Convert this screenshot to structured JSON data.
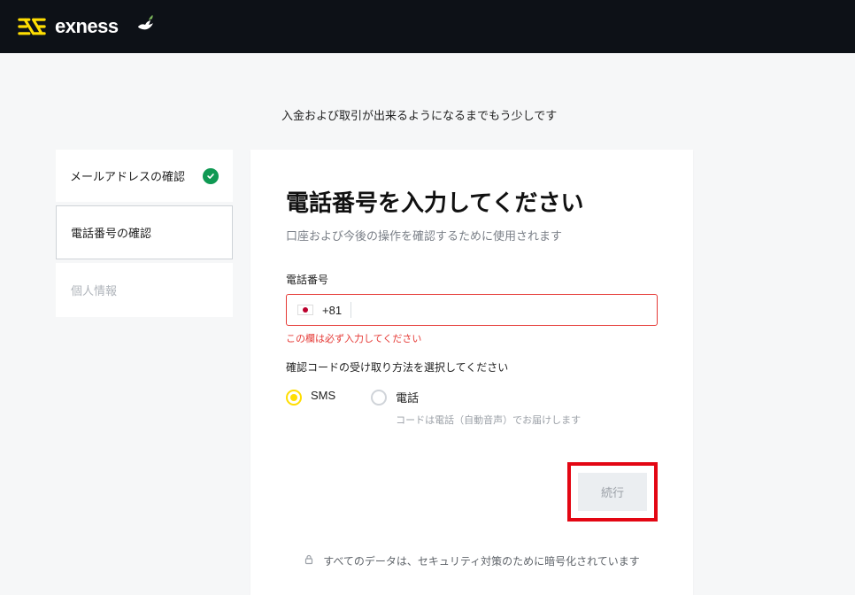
{
  "brand": {
    "name": "exness"
  },
  "page_subtitle": "入金および取引が出来るようになるまでもう少しです",
  "sidebar": {
    "items": [
      {
        "label": "メールアドレスの確認",
        "status": "completed"
      },
      {
        "label": "電話番号の確認",
        "status": "active"
      },
      {
        "label": "個人情報",
        "status": "disabled"
      }
    ]
  },
  "form": {
    "title": "電話番号を入力してください",
    "description": "口座および今後の操作を確認するために使用されます",
    "phone_field_label": "電話番号",
    "dial_code": "+81",
    "error_message": "この欄は必ず入力してください",
    "method_label": "確認コードの受け取り方法を選択してください",
    "radio_options": {
      "sms": {
        "label": "SMS",
        "selected": true
      },
      "phone": {
        "label": "電話",
        "hint": "コードは電話（自動音声）でお届けします",
        "selected": false
      }
    },
    "continue_label": "続行"
  },
  "security_note": "すべてのデータは、セキュリティ対策のために暗号化されています"
}
